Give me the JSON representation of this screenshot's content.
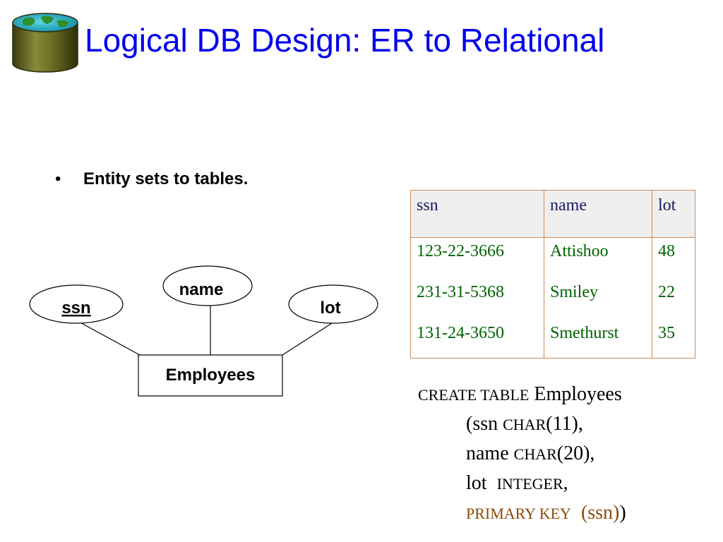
{
  "title": "Logical DB Design: ER to Relational",
  "bullet": {
    "symbol": "•",
    "text": "Entity sets to tables."
  },
  "er": {
    "entity": "Employees",
    "attributes": {
      "ssn": "ssn",
      "name": "name",
      "lot": "lot"
    },
    "key_attribute": "ssn"
  },
  "table": {
    "headers": [
      "ssn",
      "name",
      "lot"
    ],
    "rows": [
      [
        "123-22-3666",
        "Attishoo",
        "48"
      ],
      [
        "231-31-5368",
        "Smiley",
        "22"
      ],
      [
        "131-24-3650",
        "Smethurst",
        "35"
      ]
    ]
  },
  "sql": {
    "create_kw": "CREATE TABLE",
    "table_name": "Employees",
    "ssn_prefix": "(ssn",
    "char_kw": "CHAR",
    "ssn_size": "(11),",
    "name_col": "name",
    "name_size": "(20),",
    "lot_col": "lot",
    "integer_kw": "INTEGER",
    "comma": ",",
    "pk_kw": "PRIMARY KEY",
    "pk_cols": "(ssn)",
    "close": ")"
  },
  "colors": {
    "title": "#0000ee",
    "table_header_text": "#1a1a66",
    "table_cell_text": "#006400",
    "table_border": "#c98a5a",
    "primary_key": "#8b4a0a"
  }
}
